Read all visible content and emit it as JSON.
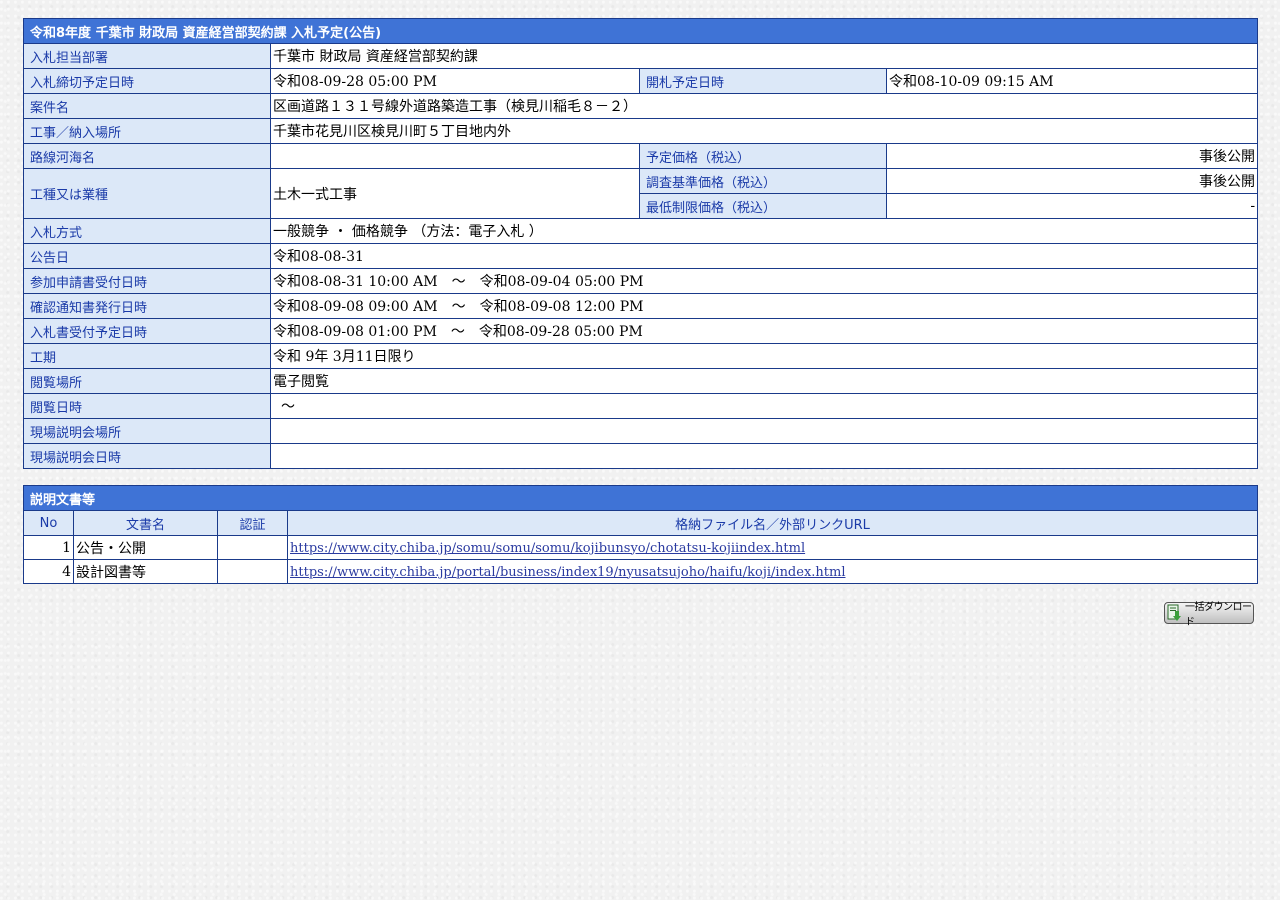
{
  "bid": {
    "title": "令和8年度 千葉市 財政局 資産経営部契約課 入札予定(公告)",
    "rows": {
      "department": {
        "label": "入札担当部署",
        "value": "千葉市 財政局 資産経営部契約課"
      },
      "deadline": {
        "label": "入札締切予定日時",
        "value": "令和08-09-28 05:00 PM"
      },
      "opening": {
        "label": "開札予定日時",
        "value": "令和08-10-09 09:15 AM"
      },
      "case_name": {
        "label": "案件名",
        "value": "区画道路１３１号線外道路築造工事（検見川稲毛８－２）"
      },
      "location": {
        "label": "工事／納入場所",
        "value": "千葉市花見川区検見川町５丁目地内外"
      },
      "route": {
        "label": "路線河海名",
        "value": ""
      },
      "planned_price": {
        "label": "予定価格（税込）",
        "value": "事後公開"
      },
      "work_type": {
        "label": "工種又は業種",
        "value": "土木一式工事"
      },
      "survey_price": {
        "label": "調査基準価格（税込）",
        "value": "事後公開"
      },
      "min_price": {
        "label": "最低制限価格（税込）",
        "value": "-"
      },
      "method": {
        "label": "入札方式",
        "value": "一般競争 ・ 価格競争 （方法：電子入札 ）"
      },
      "announce_date": {
        "label": "公告日",
        "value": "令和08-08-31"
      },
      "application_period": {
        "label": "参加申請書受付日時",
        "value": "令和08-08-31 10:00 AM　～　令和08-09-04 05:00 PM"
      },
      "confirmation": {
        "label": "確認通知書発行日時",
        "value": "令和08-09-08 09:00 AM　～　令和08-09-08 12:00 PM"
      },
      "bid_receipt": {
        "label": "入札書受付予定日時",
        "value": "令和08-09-08 01:00 PM　～　令和08-09-28 05:00 PM"
      },
      "period": {
        "label": "工期",
        "value": "令和 9年 3月11日限り"
      },
      "viewing_place": {
        "label": "閲覧場所",
        "value": "電子閲覧"
      },
      "viewing_time": {
        "label": "閲覧日時",
        "value": "～"
      },
      "briefing_place": {
        "label": "現場説明会場所",
        "value": ""
      },
      "briefing_time": {
        "label": "現場説明会日時",
        "value": ""
      }
    }
  },
  "docs": {
    "title": "説明文書等",
    "headers": {
      "no": "No",
      "name": "文書名",
      "auth": "認証",
      "file": "格納ファイル名／外部リンクURL"
    },
    "items": [
      {
        "no": "1",
        "name": "公告・公開",
        "auth": "",
        "url": "https://www.city.chiba.jp/somu/somu/somu/kojibunsyo/chotatsu-kojiindex.html"
      },
      {
        "no": "4",
        "name": "設計図書等",
        "auth": "",
        "url": "https://www.city.chiba.jp/portal/business/index19/nyusatsujoho/haifu/koji/index.html"
      }
    ]
  },
  "download": {
    "label": "一括ダウンロード",
    "icon": "download-file-icon"
  }
}
